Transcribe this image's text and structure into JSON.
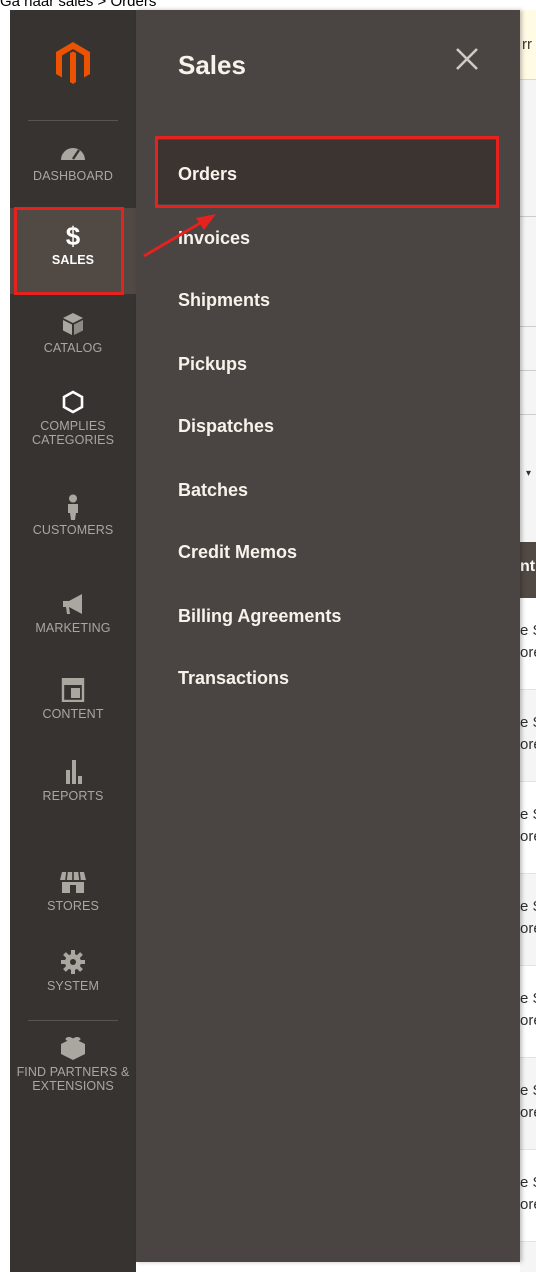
{
  "caption": "Ga naar sales > Orders",
  "brand_colors": {
    "menu_bg": "#373330",
    "submenu_bg": "#4a4542",
    "highlight": "#e5221d",
    "logo": "#eb5202"
  },
  "sidebar": {
    "logo": "magento-logo",
    "items": [
      {
        "label": "DASHBOARD",
        "icon": "speedometer-icon"
      },
      {
        "label": "SALES",
        "icon": "dollar-icon",
        "active": true
      },
      {
        "label": "CATALOG",
        "icon": "box-icon"
      },
      {
        "label": "COMPLIES CATEGORIES",
        "icon": "hexagon-icon"
      },
      {
        "label": "CUSTOMERS",
        "icon": "person-icon"
      },
      {
        "label": "MARKETING",
        "icon": "megaphone-icon"
      },
      {
        "label": "CONTENT",
        "icon": "layout-icon"
      },
      {
        "label": "REPORTS",
        "icon": "bar-chart-icon"
      },
      {
        "label": "STORES",
        "icon": "storefront-icon"
      },
      {
        "label": "SYSTEM",
        "icon": "gear-icon"
      },
      {
        "label": "FIND PARTNERS & EXTENSIONS",
        "icon": "lego-block-icon"
      }
    ]
  },
  "submenu": {
    "title": "Sales",
    "close_icon": "close-icon",
    "items": [
      {
        "label": "Orders",
        "highlighted": true
      },
      {
        "label": "Invoices"
      },
      {
        "label": "Shipments"
      },
      {
        "label": "Pickups"
      },
      {
        "label": "Dispatches"
      },
      {
        "label": "Batches"
      },
      {
        "label": "Credit Memos"
      },
      {
        "label": "Billing Agreements"
      },
      {
        "label": "Transactions"
      }
    ]
  },
  "background_page": {
    "notice_fragment": "rr",
    "column_header_fragment": "nt",
    "row_fragment_1": "e S",
    "row_fragment_2": "ore"
  }
}
